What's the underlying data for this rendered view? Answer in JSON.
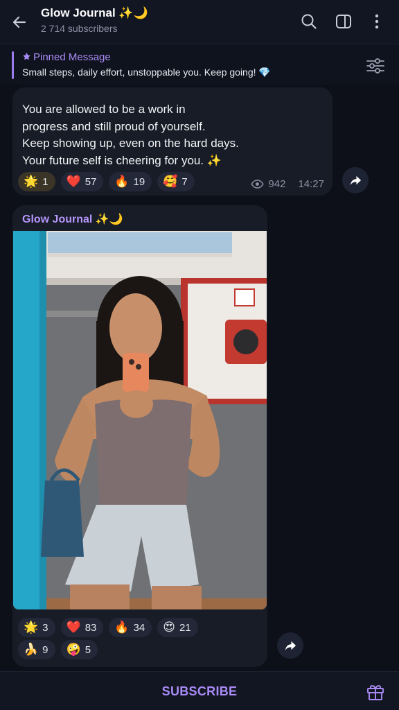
{
  "header": {
    "title": "Glow Journal ✨🌙",
    "subscribers": "2 714 subscribers",
    "icons": [
      "back-arrow-icon",
      "search-icon",
      "sidebar-icon",
      "more-vertical-icon"
    ]
  },
  "pinned": {
    "title": "Pinned Message",
    "text": "Small steps, daily effort, unstoppable you. Keep going! 💎"
  },
  "post1": {
    "lines": [
      "You are allowed to be a work in",
      "progress and still proud of yourself.",
      "Keep showing up, even on the hard days.",
      "Your future self is cheering for you. ✨"
    ],
    "reactions": [
      {
        "emoji": "🌟",
        "count": "1"
      },
      {
        "emoji": "❤️",
        "count": "57"
      },
      {
        "emoji": "🔥",
        "count": "19"
      },
      {
        "emoji": "🥰",
        "count": "7"
      }
    ],
    "views": "942",
    "time": "14:27"
  },
  "post2": {
    "author": "Glow Journal ✨🌙",
    "reactions_row1": [
      {
        "emoji": "🌟",
        "count": "3"
      },
      {
        "emoji": "❤️",
        "count": "83"
      },
      {
        "emoji": "🔥",
        "count": "34"
      },
      {
        "emoji": "😍",
        "count": "21"
      }
    ],
    "reactions_row2": [
      {
        "emoji": "🍌",
        "count": "9"
      },
      {
        "emoji": "🤪",
        "count": "5"
      }
    ]
  },
  "bottom": {
    "subscribe_label": "SUBSCRIBE"
  },
  "colors": {
    "background": "#0d1019",
    "bubble": "#181c27",
    "accent": "#a98bf7"
  }
}
